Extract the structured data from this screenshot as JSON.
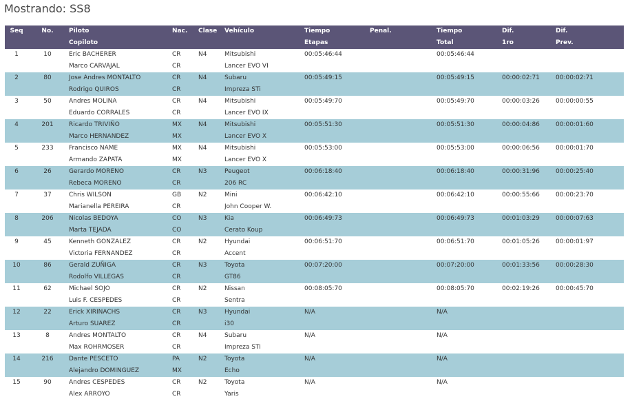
{
  "page": {
    "title": "Mostrando: SS8"
  },
  "table": {
    "headers": {
      "seq": "Seq",
      "no": "No.",
      "piloto": "Piloto",
      "copiloto": "Copiloto",
      "nac": "Nac.",
      "clase": "Clase",
      "vehiculo": "Vehículo",
      "tiempo_etapas_1": "Tiempo",
      "tiempo_etapas_2": "Etapas",
      "penal": "Penal.",
      "tiempo_total_1": "Tiempo",
      "tiempo_total_2": "Total",
      "dif_1ro_1": "Dif.",
      "dif_1ro_2": "1ro",
      "dif_prev_1": "Dif.",
      "dif_prev_2": "Prev."
    },
    "rows": [
      {
        "seq": "1",
        "no": "10",
        "piloto": "Eric BACHERER",
        "copiloto": "Marco CARVAJAL",
        "nac1": "CR",
        "nac2": "CR",
        "clase": "N4",
        "marca": "Mitsubishi",
        "modelo": "Lancer EVO VI",
        "tiempo": "00:05:46:44",
        "penal": "",
        "total": "00:05:46:44",
        "dif1": "",
        "difprev": ""
      },
      {
        "seq": "2",
        "no": "80",
        "piloto": "Jose Andres MONTALTO",
        "copiloto": "Rodrigo QUIROS",
        "nac1": "CR",
        "nac2": "CR",
        "clase": "N4",
        "marca": "Subaru",
        "modelo": "Impreza STi",
        "tiempo": "00:05:49:15",
        "penal": "",
        "total": "00:05:49:15",
        "dif1": "00:00:02:71",
        "difprev": "00:00:02:71"
      },
      {
        "seq": "3",
        "no": "50",
        "piloto": "Andres MOLINA",
        "copiloto": "Eduardo CORRALES",
        "nac1": "CR",
        "nac2": "CR",
        "clase": "N4",
        "marca": "Mitsubishi",
        "modelo": "Lancer EVO IX",
        "tiempo": "00:05:49:70",
        "penal": "",
        "total": "00:05:49:70",
        "dif1": "00:00:03:26",
        "difprev": "00:00:00:55"
      },
      {
        "seq": "4",
        "no": "201",
        "piloto": "Ricardo TRIVIÑO",
        "copiloto": "Marco HERNANDEZ",
        "nac1": "MX",
        "nac2": "MX",
        "clase": "N4",
        "marca": "Mitsubishi",
        "modelo": "Lancer EVO X",
        "tiempo": "00:05:51:30",
        "penal": "",
        "total": "00:05:51:30",
        "dif1": "00:00:04:86",
        "difprev": "00:00:01:60"
      },
      {
        "seq": "5",
        "no": "233",
        "piloto": "Francisco NAME",
        "copiloto": "Armando ZAPATA",
        "nac1": "MX",
        "nac2": "MX",
        "clase": "N4",
        "marca": "Mitsubishi",
        "modelo": "Lancer EVO X",
        "tiempo": "00:05:53:00",
        "penal": "",
        "total": "00:05:53:00",
        "dif1": "00:00:06:56",
        "difprev": "00:00:01:70"
      },
      {
        "seq": "6",
        "no": "26",
        "piloto": "Gerardo MORENO",
        "copiloto": "Rebeca MORENO",
        "nac1": "CR",
        "nac2": "CR",
        "clase": "N3",
        "marca": "Peugeot",
        "modelo": "206 RC",
        "tiempo": "00:06:18:40",
        "penal": "",
        "total": "00:06:18:40",
        "dif1": "00:00:31:96",
        "difprev": "00:00:25:40"
      },
      {
        "seq": "7",
        "no": "37",
        "piloto": "Chris WILSON",
        "copiloto": "Marianella PEREIRA",
        "nac1": "GB",
        "nac2": "CR",
        "clase": "N2",
        "marca": "Mini",
        "modelo": "John Cooper W.",
        "tiempo": "00:06:42:10",
        "penal": "",
        "total": "00:06:42:10",
        "dif1": "00:00:55:66",
        "difprev": "00:00:23:70"
      },
      {
        "seq": "8",
        "no": "206",
        "piloto": "Nicolas BEDOYA",
        "copiloto": "Marta TEJADA",
        "nac1": "CO",
        "nac2": "CO",
        "clase": "N3",
        "marca": "Kia",
        "modelo": "Cerato Koup",
        "tiempo": "00:06:49:73",
        "penal": "",
        "total": "00:06:49:73",
        "dif1": "00:01:03:29",
        "difprev": "00:00:07:63"
      },
      {
        "seq": "9",
        "no": "45",
        "piloto": "Kenneth GONZALEZ",
        "copiloto": "Victoria FERNANDEZ",
        "nac1": "CR",
        "nac2": "CR",
        "clase": "N2",
        "marca": "Hyundai",
        "modelo": "Accent",
        "tiempo": "00:06:51:70",
        "penal": "",
        "total": "00:06:51:70",
        "dif1": "00:01:05:26",
        "difprev": "00:00:01:97"
      },
      {
        "seq": "10",
        "no": "86",
        "piloto": "Gerald ZUÑIGA",
        "copiloto": "Rodolfo VILLEGAS",
        "nac1": "CR",
        "nac2": "CR",
        "clase": "N3",
        "marca": "Toyota",
        "modelo": "GT86",
        "tiempo": "00:07:20:00",
        "penal": "",
        "total": "00:07:20:00",
        "dif1": "00:01:33:56",
        "difprev": "00:00:28:30"
      },
      {
        "seq": "11",
        "no": "62",
        "piloto": "Michael SOJO",
        "copiloto": "Luis F. CESPEDES",
        "nac1": "CR",
        "nac2": "CR",
        "clase": "N2",
        "marca": "Nissan",
        "modelo": "Sentra",
        "tiempo": "00:08:05:70",
        "penal": "",
        "total": "00:08:05:70",
        "dif1": "00:02:19:26",
        "difprev": "00:00:45:70"
      },
      {
        "seq": "12",
        "no": "22",
        "piloto": "Erick XIRINACHS",
        "copiloto": "Arturo SUAREZ",
        "nac1": "CR",
        "nac2": "CR",
        "clase": "N3",
        "marca": "Hyundai",
        "modelo": "i30",
        "tiempo": "N/A",
        "penal": "",
        "total": "N/A",
        "dif1": "",
        "difprev": ""
      },
      {
        "seq": "13",
        "no": "8",
        "piloto": "Andres MONTALTO",
        "copiloto": "Max ROHRMOSER",
        "nac1": "CR",
        "nac2": "CR",
        "clase": "N4",
        "marca": "Subaru",
        "modelo": "Impreza STi",
        "tiempo": "N/A",
        "penal": "",
        "total": "N/A",
        "dif1": "",
        "difprev": ""
      },
      {
        "seq": "14",
        "no": "216",
        "piloto": "Dante PESCETO",
        "copiloto": "Alejandro DOMINGUEZ",
        "nac1": "PA",
        "nac2": "MX",
        "clase": "N2",
        "marca": "Toyota",
        "modelo": "Echo",
        "tiempo": "N/A",
        "penal": "",
        "total": "N/A",
        "dif1": "",
        "difprev": ""
      },
      {
        "seq": "15",
        "no": "90",
        "piloto": "Andres CESPEDES",
        "copiloto": "Alex ARROYO",
        "nac1": "CR",
        "nac2": "CR",
        "clase": "N2",
        "marca": "Toyota",
        "modelo": "Yaris",
        "tiempo": "N/A",
        "penal": "",
        "total": "N/A",
        "dif1": "",
        "difprev": ""
      }
    ]
  }
}
